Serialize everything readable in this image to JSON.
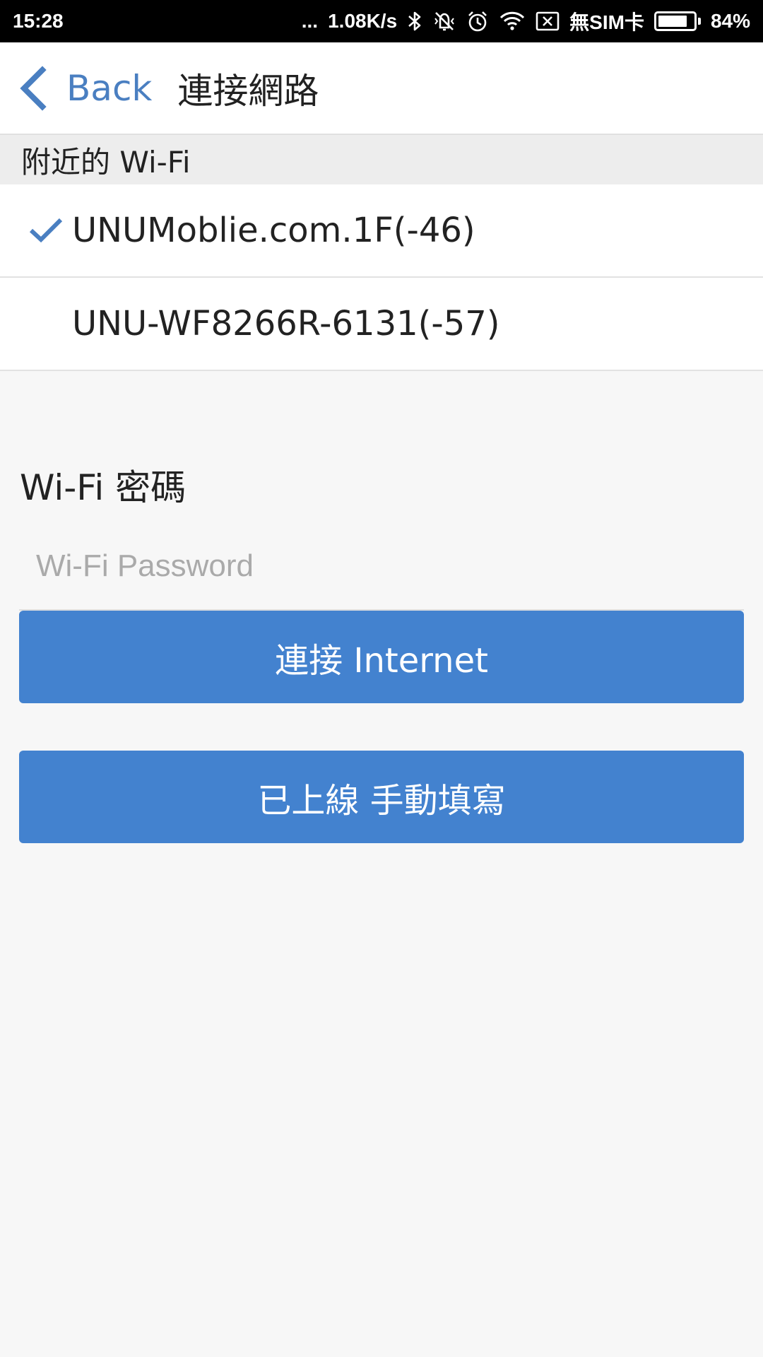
{
  "status_bar": {
    "time": "15:28",
    "dots": "...",
    "net_speed": "1.08K/s",
    "sim_status": "無SIM卡",
    "battery_percent": "84%",
    "battery_level": 0.84,
    "icons": [
      "bluetooth-icon",
      "vibrate-off-icon",
      "alarm-icon",
      "wifi-icon",
      "sim-x-icon",
      "battery-icon"
    ]
  },
  "nav": {
    "back_label": "Back",
    "title": "連接網路",
    "accent_color": "#4a7fc1"
  },
  "wifi_section": {
    "header": "附近的 Wi-Fi",
    "networks": [
      {
        "name": "UNUMoblie.com.1F(-46)",
        "selected": true
      },
      {
        "name": "UNU-WF8266R-6131(-57)",
        "selected": false
      }
    ]
  },
  "password": {
    "label": "Wi-Fi 密碼",
    "placeholder": "Wi-Fi Password",
    "value": ""
  },
  "buttons": {
    "connect_label": "連接 Internet",
    "manual_label": "已上線 手動填寫",
    "color": "#4382cf"
  }
}
